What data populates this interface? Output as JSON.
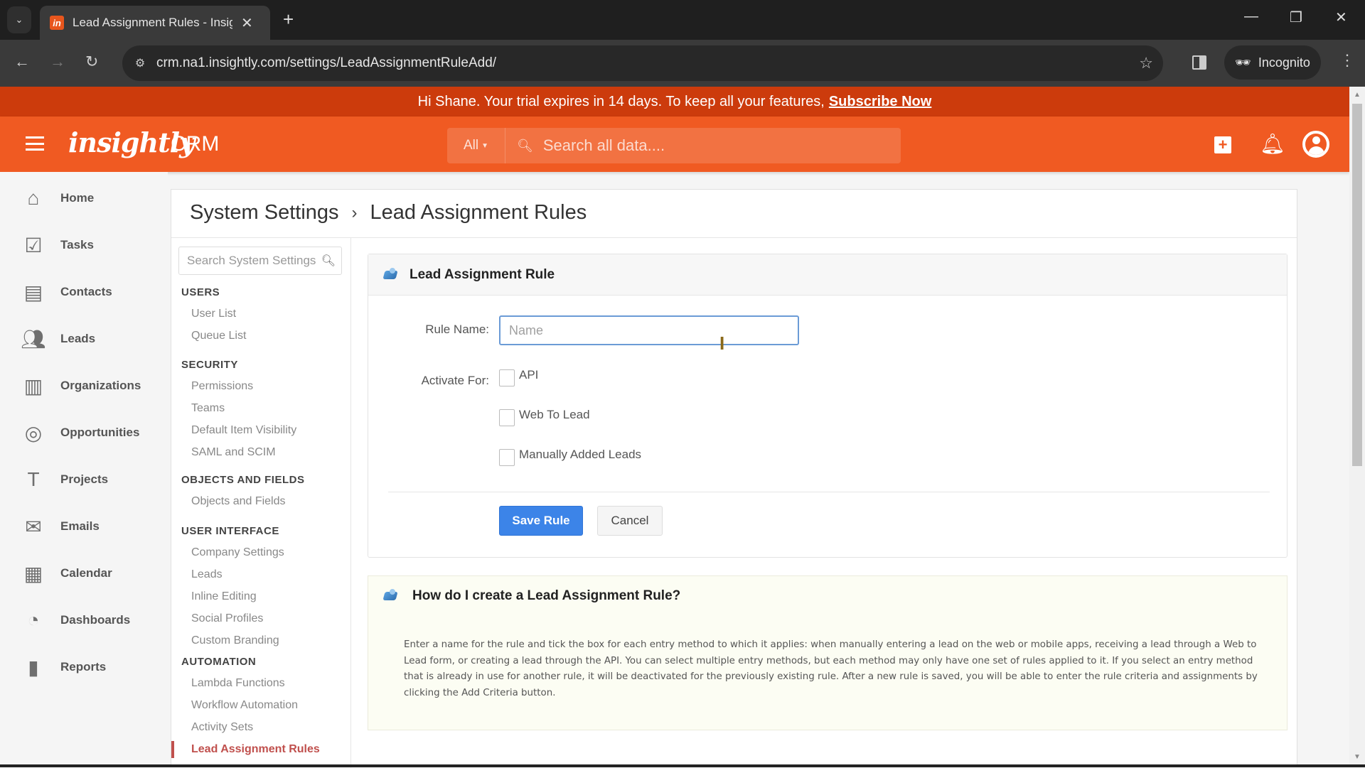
{
  "browser": {
    "tab_title": "Lead Assignment Rules - Insightly",
    "favicon_text": "in",
    "url": "crm.na1.insightly.com/settings/LeadAssignmentRuleAdd/",
    "incognito_label": "Incognito"
  },
  "banner": {
    "message": "Hi Shane. Your trial expires in 14 days. To keep all your features,",
    "link": "Subscribe Now"
  },
  "header": {
    "logo": "insightly",
    "product": "CRM",
    "search_scope": "All",
    "search_placeholder": "Search all data...."
  },
  "leftnav": [
    {
      "label": "Home",
      "icon": "home-icon"
    },
    {
      "label": "Tasks",
      "icon": "tasks-icon"
    },
    {
      "label": "Contacts",
      "icon": "contacts-icon"
    },
    {
      "label": "Leads",
      "icon": "leads-icon"
    },
    {
      "label": "Organizations",
      "icon": "organizations-icon"
    },
    {
      "label": "Opportunities",
      "icon": "opportunities-icon"
    },
    {
      "label": "Projects",
      "icon": "projects-icon"
    },
    {
      "label": "Emails",
      "icon": "emails-icon"
    },
    {
      "label": "Calendar",
      "icon": "calendar-icon"
    },
    {
      "label": "Dashboards",
      "icon": "dashboards-icon"
    },
    {
      "label": "Reports",
      "icon": "reports-icon"
    }
  ],
  "breadcrumb": {
    "parent": "System Settings",
    "separator": "›",
    "current": "Lead Assignment Rules"
  },
  "settings_nav": {
    "search_placeholder": "Search System Settings",
    "sections": [
      {
        "title": "USERS",
        "items": [
          "User List",
          "Queue List"
        ]
      },
      {
        "title": "SECURITY",
        "items": [
          "Permissions",
          "Teams",
          "Default Item Visibility",
          "SAML and SCIM"
        ]
      },
      {
        "title": "OBJECTS AND FIELDS",
        "items": [
          "Objects and Fields"
        ]
      },
      {
        "title": "USER INTERFACE",
        "items": [
          "Company Settings",
          "Leads",
          "Inline Editing",
          "Social Profiles",
          "Custom Branding"
        ]
      },
      {
        "title": "AUTOMATION",
        "items": [
          "Lambda Functions",
          "Workflow Automation",
          "Activity Sets",
          "Lead Assignment Rules"
        ]
      }
    ],
    "active_item": "Lead Assignment Rules"
  },
  "form": {
    "title": "Lead Assignment Rule",
    "rule_name_label": "Rule Name:",
    "rule_name_value": "",
    "rule_name_placeholder": "Name",
    "activate_label": "Activate For:",
    "options": [
      {
        "label": "API",
        "checked": false
      },
      {
        "label": "Web To Lead",
        "checked": false
      },
      {
        "label": "Manually Added Leads",
        "checked": false
      }
    ],
    "save_label": "Save Rule",
    "cancel_label": "Cancel"
  },
  "help": {
    "title": "How do I create a Lead Assignment Rule?",
    "body": "Enter a name for the rule and tick the box for each entry method to which it applies: when manually entering a lead on the web or mobile apps, receiving a lead through a Web to Lead form, or creating a lead through the API. You can select multiple entry methods, but each method may only have one set of rules applied to it. If you select an entry method that is already in use for another rule, it will be deactivated for the previously existing rule. After a new rule is saved, you will be able to enter the rule criteria and assignments by clicking the Add Criteria button."
  },
  "colors": {
    "brand_orange": "#f05a22",
    "banner_red": "#cc3b0c",
    "primary_blue": "#3c84e8",
    "active_link": "#c0504d"
  }
}
